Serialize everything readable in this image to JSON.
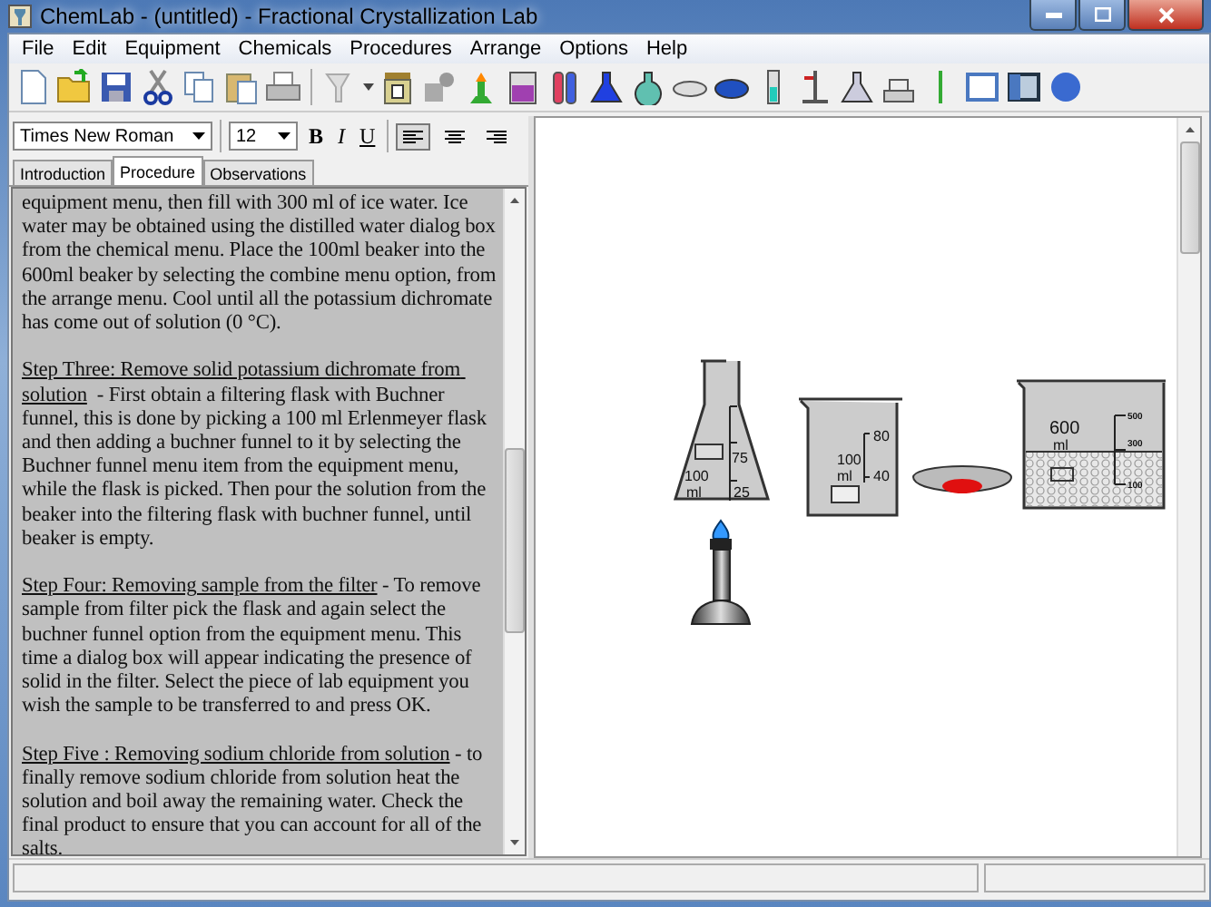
{
  "window": {
    "title": "ChemLab - (untitled) - Fractional Crystallization Lab"
  },
  "menu": [
    "File",
    "Edit",
    "Equipment",
    "Chemicals",
    "Procedures",
    "Arrange",
    "Options",
    "Help"
  ],
  "format_bar": {
    "font": "Times New Roman",
    "size": "12",
    "bold": "B",
    "italic": "I",
    "underline": "U"
  },
  "align_buttons": [
    {
      "kind": "left",
      "selected": true
    },
    {
      "kind": "center",
      "selected": false
    },
    {
      "kind": "right",
      "selected": false
    }
  ],
  "tabs": [
    {
      "label": "Introduction",
      "selected": false
    },
    {
      "label": "Procedure",
      "selected": true
    },
    {
      "label": "Observations",
      "selected": false
    }
  ],
  "procedure": [
    {
      "body": "equipment menu, then fill with 300 ml of ice water. Ice water may be obtained using the distilled water dialog box from the chemical menu. Place the 100ml beaker into the 600ml beaker by selecting the combine menu option, from the arrange menu. Cool until all the potassium dichromate has come out of solution (0 °C)."
    },
    {
      "heading": "Step Three: Remove solid potassium dichromate from solution",
      "body": "  - First obtain a filtering flask with Buchner funnel, this is done by picking a 100 ml Erlenmeyer flask and then adding a buchner funnel to it by selecting the Buchner funnel menu item from the equipment menu, while the flask is picked. Then pour the solution from the beaker into the filtering flask with buchner funnel, until beaker is empty."
    },
    {
      "heading": "Step Four: Removing sample from the filter",
      "body": " - To remove sample from filter pick the flask and again select the buchner funnel option from the equipment menu. This time a dialog box will appear indicating the presence of solid in the filter. Select the piece of lab equipment you wish the sample to be transferred to and press OK."
    },
    {
      "heading": "Step Five : Removing sodium chloride from solution",
      "body": " - to finally remove sodium chloride from solution heat the solution and boil away the remaining water. Check the final product to ensure that you can account for all of the salts."
    }
  ],
  "equipment": [
    {
      "kind": "flask",
      "labels": [
        "75",
        "100",
        "ml",
        "25"
      ]
    },
    {
      "kind": "beaker",
      "labels": [
        "80",
        "100",
        "ml",
        "40"
      ]
    },
    {
      "kind": "dish"
    },
    {
      "kind": "large-beaker",
      "labels": [
        "600",
        "ml",
        "500",
        "300",
        "100"
      ]
    },
    {
      "kind": "burner"
    }
  ]
}
